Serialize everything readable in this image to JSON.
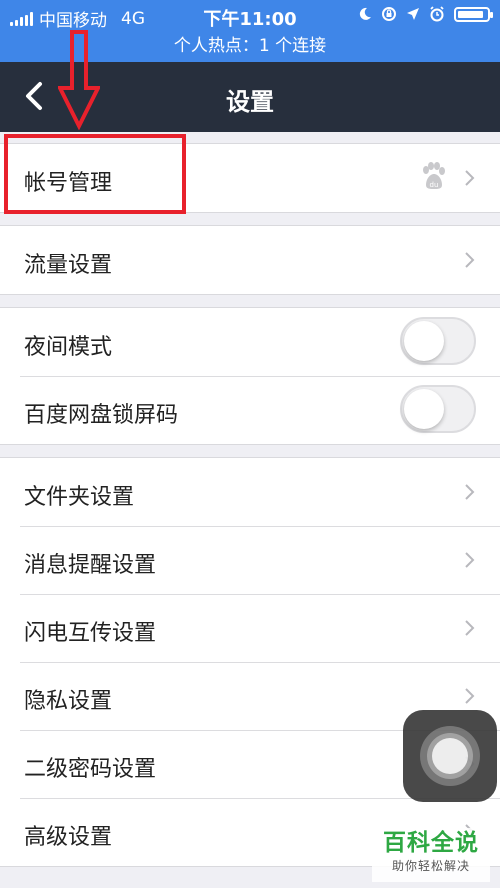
{
  "status_bar": {
    "carrier": "中国移动",
    "network": "4G",
    "time": "下午11:00",
    "battery_level": 0.9
  },
  "hotspot": {
    "text": "个人热点：1 个连接"
  },
  "nav": {
    "title": "设置"
  },
  "groups": [
    {
      "rows": [
        {
          "label": "帐号管理",
          "accessory": "baidu-icon+chevron"
        }
      ]
    },
    {
      "rows": [
        {
          "label": "流量设置",
          "accessory": "chevron"
        }
      ]
    },
    {
      "rows": [
        {
          "label": "夜间模式",
          "accessory": "toggle",
          "on": false
        },
        {
          "label": "百度网盘锁屏码",
          "accessory": "toggle",
          "on": false
        }
      ]
    },
    {
      "rows": [
        {
          "label": "文件夹设置",
          "accessory": "chevron"
        },
        {
          "label": "消息提醒设置",
          "accessory": "chevron"
        },
        {
          "label": "闪电互传设置",
          "accessory": "chevron"
        },
        {
          "label": "隐私设置",
          "accessory": "chevron"
        },
        {
          "label": "二级密码设置",
          "accessory": "chevron"
        },
        {
          "label": "高级设置",
          "accessory": "chevron"
        }
      ]
    }
  ],
  "annotation": {
    "color": "#e8212c"
  },
  "watermark": {
    "title": "百科全说",
    "subtitle": "助你轻松解决"
  },
  "colors": {
    "status_bar": "#3f86e8",
    "nav_bar": "#272f3d",
    "background": "#efeff4"
  }
}
